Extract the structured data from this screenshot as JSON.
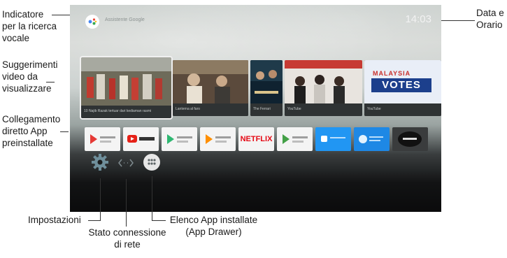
{
  "callouts": {
    "voice": [
      "Indicatore",
      "per la ricerca",
      "vocale"
    ],
    "suggestions": [
      "Suggerimenti",
      "video da",
      "visualizzare"
    ],
    "apps_direct": [
      "Collegamento",
      "diretto App",
      "preinstallate"
    ],
    "datetime": [
      "Data e",
      "Orario"
    ],
    "settings": "Impostazioni",
    "network": [
      "Stato connessione",
      "di rete"
    ],
    "drawer": [
      "Elenco App installate",
      "(App Drawer)"
    ]
  },
  "screen": {
    "search_hint": "Assistente Google",
    "clock": "14:03",
    "video_tiles": [
      {
        "caption": "10 Najib Razak tertuar dari kediaman rasmi"
      },
      {
        "caption": "Lanterna al faro"
      },
      {
        "caption": "The Ferrari"
      },
      {
        "caption": "YouTube"
      },
      {
        "caption": "YouTube"
      }
    ],
    "apps": [
      {
        "label": "Google Play Movies & TV"
      },
      {
        "label": "YouTube"
      },
      {
        "label": "Google Play Store"
      },
      {
        "label": "Google Play Music"
      },
      {
        "label": "NETFLIX"
      },
      {
        "label": "Google Play Games"
      },
      {
        "label": "Live Channels"
      },
      {
        "label": "Photos & Videos"
      },
      {
        "label": "Aptoide"
      }
    ],
    "tile_text": {
      "votes_banner_top": "MALAYSIA",
      "votes_banner_main": "VOTES"
    }
  },
  "colors": {
    "youtube_red": "#e62117",
    "netflix_red": "#e50914",
    "play_green": "#2eb872",
    "votes_blue": "#1c3f8c"
  }
}
